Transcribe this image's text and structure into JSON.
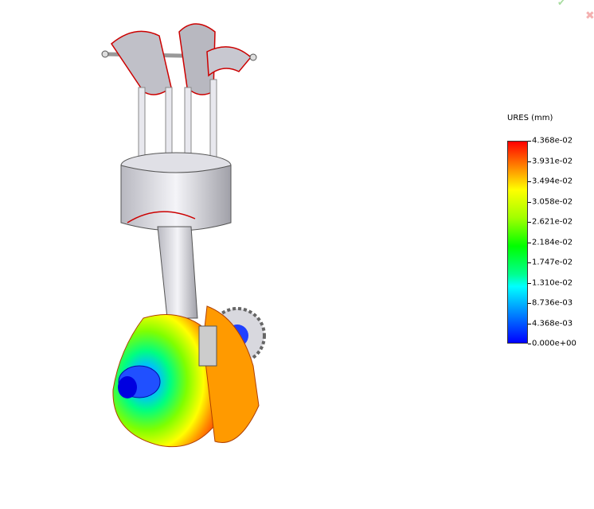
{
  "legend": {
    "title": "URES (mm)",
    "labels": [
      "4.368e-02",
      "3.931e-02",
      "3.494e-02",
      "3.058e-02",
      "2.621e-02",
      "2.184e-02",
      "1.747e-02",
      "1.310e-02",
      "8.736e-03",
      "4.368e-03",
      "0.000e+00"
    ],
    "max_color": "#ff0000",
    "min_color": "#0000ff"
  },
  "corner_icons": {
    "accept": "check-icon",
    "cancel": "close-icon",
    "accept_glyph": "✔",
    "cancel_glyph": "✖"
  }
}
